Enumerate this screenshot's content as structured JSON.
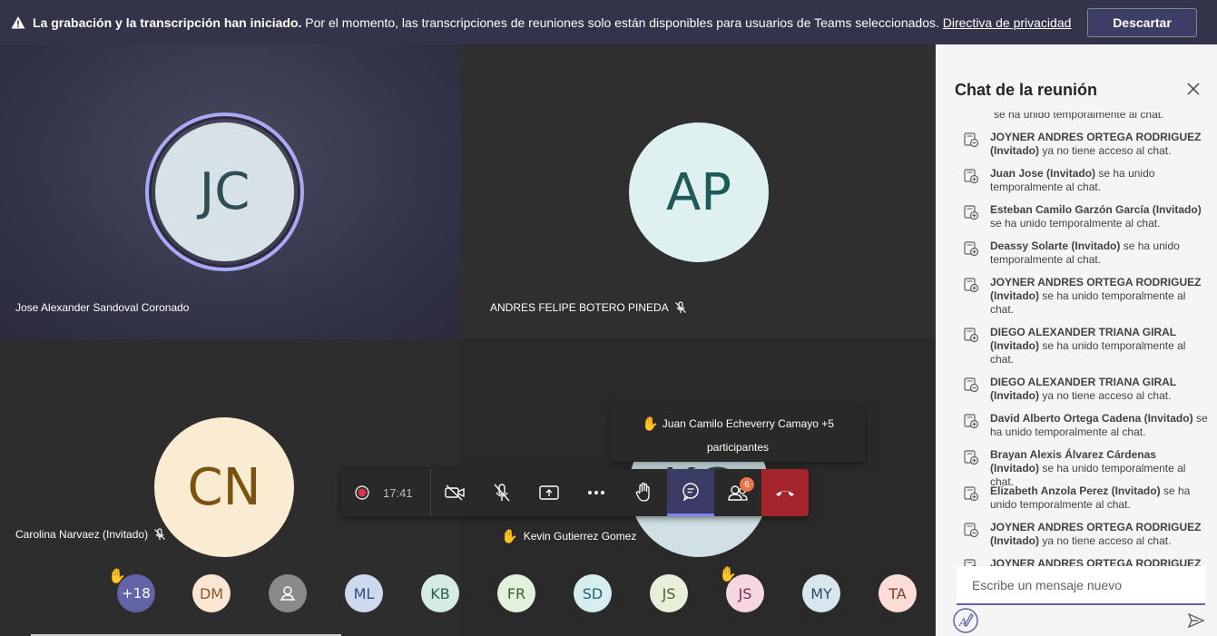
{
  "banner": {
    "bold_text": "La grabación y la transcripción han iniciado.",
    "text": "Por el momento, las transcripciones de reuniones solo están disponibles para usuarios de Teams seleccionados.",
    "link": "Directiva de privacidad",
    "dismiss_label": "Descartar"
  },
  "tiles": [
    {
      "initials": "JC",
      "name": "Jose Alexander Sandoval Coronado",
      "muted": false,
      "avatar_bg": "#d6e2e6",
      "text_color": "#2e4d55"
    },
    {
      "initials": "AP",
      "name": "ANDRES FELIPE BOTERO PINEDA",
      "muted": true,
      "avatar_bg": "#dff0f0",
      "text_color": "#1f5a5a"
    },
    {
      "initials": "CN",
      "name": "Carolina Narvaez (Invitado)",
      "muted": true,
      "avatar_bg": "#f9ecd2",
      "text_color": "#7a5310"
    },
    {
      "initials": "KG",
      "name": "Kevin Gutierrez Gomez",
      "muted": false,
      "avatar_bg": "#d0e0e4",
      "text_color": "#2e4d55"
    }
  ],
  "hand_tooltip": {
    "line1": "Juan Camilo Echeverry Camayo +5",
    "line2": "participantes"
  },
  "toolbar": {
    "timer": "17:41",
    "people_badge": "6"
  },
  "roster": [
    {
      "label": "+18",
      "bg": "#6264a7",
      "color": "#ffffff",
      "hand": true
    },
    {
      "label": "DM",
      "bg": "#fbe6d4",
      "color": "#8a5a2a",
      "hand": false
    },
    {
      "label": "",
      "bg": "#8a8a8a",
      "color": "#ffffff",
      "hand": false,
      "icon": "person-icon"
    },
    {
      "label": "ML",
      "bg": "#cfd9ee",
      "color": "#2f4a7a",
      "hand": false
    },
    {
      "label": "KB",
      "bg": "#d5ece3",
      "color": "#2f5c4a",
      "hand": false
    },
    {
      "label": "FR",
      "bg": "#e3f0dc",
      "color": "#3d5f2c",
      "hand": false
    },
    {
      "label": "SD",
      "bg": "#d6eef0",
      "color": "#2a6066",
      "hand": false
    },
    {
      "label": "JS",
      "bg": "#e7efd9",
      "color": "#4b5e2a",
      "hand": false
    },
    {
      "label": "JS",
      "bg": "#f6d6e3",
      "color": "#7a2c4c",
      "hand": true
    },
    {
      "label": "MY",
      "bg": "#d8e6ee",
      "color": "#2c4d66",
      "hand": false
    },
    {
      "label": "TA",
      "bg": "#fbdcd6",
      "color": "#8a3a2c",
      "hand": false
    }
  ],
  "chat": {
    "title": "Chat de la reunión",
    "clipped_top": "se ha unido temporalmente al chat.",
    "messages": [
      {
        "name": "JOYNER ANDRES ORTEGA RODRIGUEZ (Invitado)",
        "action": "ya no tiene acceso al chat.",
        "icon": "chat-leave-icon"
      },
      {
        "name": "Juan Jose (Invitado)",
        "action": "se ha unido temporalmente al chat.",
        "icon": "chat-join-icon"
      },
      {
        "name": "Esteban Camilo Garzón García (Invitado)",
        "action": "se ha unido temporalmente al chat.",
        "icon": "chat-join-icon"
      },
      {
        "name": "Deassy Solarte (Invitado)",
        "action": "se ha unido temporalmente al chat.",
        "icon": "chat-join-icon"
      },
      {
        "name": "JOYNER ANDRES ORTEGA RODRIGUEZ (Invitado)",
        "action": "se ha unido temporalmente al chat.",
        "icon": "chat-join-icon"
      },
      {
        "name": "DIEGO ALEXANDER TRIANA GIRAL (Invitado)",
        "action": "se ha unido temporalmente al chat.",
        "icon": "chat-join-icon"
      },
      {
        "name": "DIEGO ALEXANDER TRIANA GIRAL (Invitado)",
        "action": "ya no tiene acceso al chat.",
        "icon": "chat-leave-icon"
      },
      {
        "name": "David Alberto Ortega Cadena (Invitado)",
        "action": "se ha unido temporalmente al chat.",
        "icon": "chat-join-icon"
      },
      {
        "name": "Brayan Alexis Álvarez Cárdenas (Invitado)",
        "action": "se ha unido temporalmente al chat.",
        "icon": "chat-join-icon"
      },
      {
        "name": "Elizabeth Anzola Perez (Invitado)",
        "action": "se ha unido temporalmente al chat.",
        "icon": "chat-join-icon"
      },
      {
        "name": "JOYNER ANDRES ORTEGA RODRIGUEZ (Invitado)",
        "action": "ya no tiene acceso al chat.",
        "icon": "chat-leave-icon"
      },
      {
        "name": "JOYNER ANDRES ORTEGA RODRIGUEZ",
        "action": "",
        "icon": "chat-join-icon"
      }
    ],
    "compose_placeholder": "Escribe un mensaje nuevo"
  }
}
